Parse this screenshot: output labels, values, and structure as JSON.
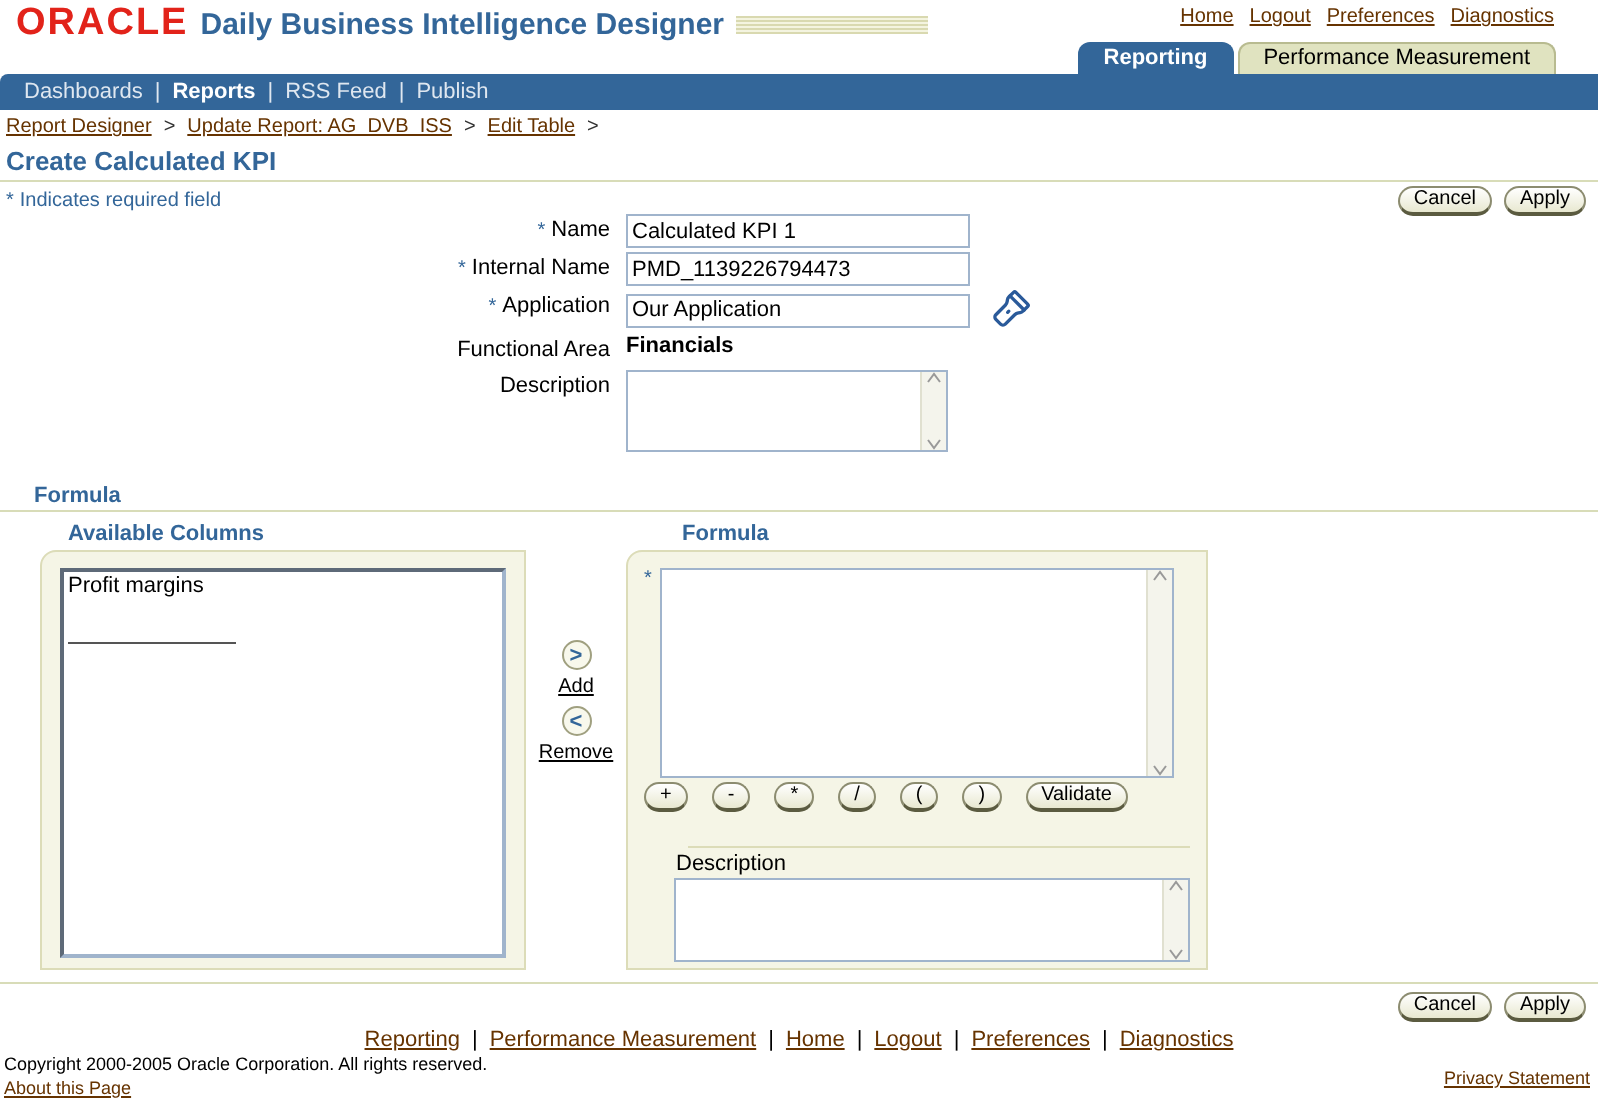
{
  "header": {
    "logo": "ORACLE",
    "title": "Daily Business Intelligence Designer"
  },
  "global_links": [
    "Home",
    "Logout",
    "Preferences",
    "Diagnostics"
  ],
  "tabs": [
    {
      "label": "Reporting",
      "selected": true
    },
    {
      "label": "Performance Measurement",
      "selected": false
    }
  ],
  "nav": [
    {
      "label": "Dashboards",
      "selected": false
    },
    {
      "label": "Reports",
      "selected": true
    },
    {
      "label": "RSS Feed",
      "selected": false
    },
    {
      "label": "Publish",
      "selected": false
    }
  ],
  "nav_separator": "|",
  "breadcrumbs": [
    "Report Designer",
    "Update Report: AG_DVB_ISS",
    "Edit Table"
  ],
  "breadcrumb_separator": ">",
  "page_title": "Create Calculated KPI",
  "required_mark": "*",
  "required_hint": "Indicates required field",
  "top_buttons": [
    "Cancel",
    "Apply"
  ],
  "bottom_buttons": [
    "Cancel",
    "Apply"
  ],
  "fields": [
    {
      "label": "Name",
      "required": true,
      "kind": "text",
      "value": "Calculated KPI 1"
    },
    {
      "label": "Internal Name",
      "required": true,
      "kind": "text",
      "value": "PMD_1139226794473"
    },
    {
      "label": "Application",
      "required": true,
      "kind": "lov",
      "value": "Our Application"
    },
    {
      "label": "Functional Area",
      "required": false,
      "kind": "static",
      "value": "Financials"
    },
    {
      "label": "Description",
      "required": false,
      "kind": "textarea"
    }
  ],
  "formula_section": {
    "title": "Formula",
    "available": {
      "title": "Available Columns",
      "items": [
        "Profit margins"
      ]
    },
    "move": [
      {
        "glyph": ">",
        "label": "Add"
      },
      {
        "glyph": "<",
        "label": "Remove"
      }
    ],
    "formula": {
      "title": "Formula",
      "required": true,
      "operators": [
        "+",
        "-",
        "*",
        "/",
        "(",
        ")",
        "Validate"
      ],
      "description_label": "Description"
    }
  },
  "footer": {
    "links": [
      "Reporting",
      "Performance Measurement",
      "Home",
      "Logout",
      "Preferences",
      "Diagnostics"
    ],
    "copyright": "Copyright 2000-2005 Oracle Corporation. All rights reserved.",
    "about": "About this Page",
    "privacy": "Privacy Statement"
  }
}
